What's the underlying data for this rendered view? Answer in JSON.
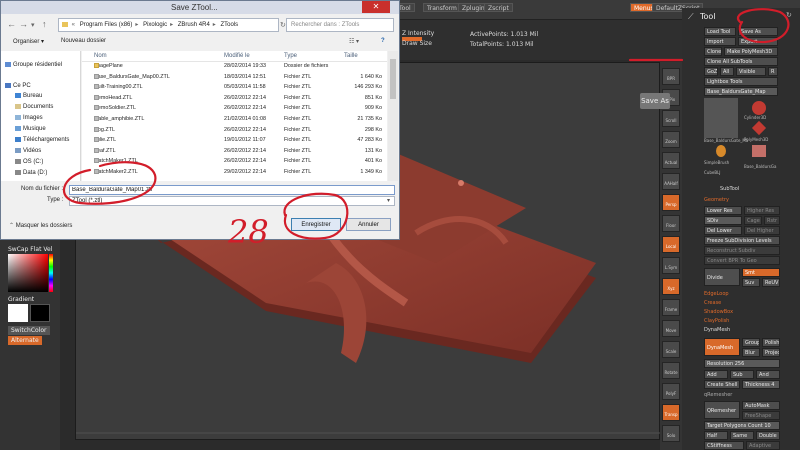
{
  "zbrush": {
    "top_menu": [
      "Tool",
      "Transform",
      "Zplugin",
      "Zscript"
    ],
    "top_right": [
      "Menus",
      "DefaultZScript"
    ],
    "shelf": {
      "left_labels": [
        "Z Intensity",
        "Draw Size"
      ],
      "active_points": "ActivePoints: 1.013 Mil",
      "total_points": "TotalPoints: 1.013 Mil"
    },
    "save_as_tooltip": "Save As",
    "left_palette": {
      "gradient": "Gradient",
      "switch_color": "SwitchColor",
      "alternate": "Alternate",
      "top_label": "SwCap  Flat  Vel"
    },
    "right_strip": [
      "BPR",
      "SPix",
      "Scroll",
      "Zoom",
      "Actual",
      "AAHalf",
      "Persp",
      "Floor",
      "Local",
      "L.Sym",
      "Xyz",
      "Frame",
      "Move",
      "Scale",
      "Rotate",
      "PolyF",
      "Transp",
      "Solo"
    ],
    "tool_palette": {
      "title": "Tool",
      "buttons": {
        "load_tool": "Load Tool",
        "save_as": "Save As",
        "import": "Import",
        "export": "Export",
        "clone": "Clone",
        "make_polymesh": "Make PolyMesh3D",
        "clone_all": "Clone All SubTools",
        "goz": "GoZ",
        "all": "All",
        "visible": "Visible",
        "r": "R",
        "lightbox_tools": "Lightbox Tools",
        "current_tool": "Base_BaldursGate_Map"
      },
      "thumbs": [
        "Base_BaldursGate_Ma",
        "Cylinder3D",
        "PolyMesh3D",
        "SimpleBrush",
        "CubeBLJ",
        "Base_BaldursGa"
      ],
      "subtool_header": "SubTool",
      "geometry_header": "Geometry",
      "rows": [
        [
          "Lower Res",
          "Higher Res"
        ],
        [
          "SDiv",
          "Cage",
          "Rstr"
        ],
        [
          "Del Lower",
          "Del Higher"
        ],
        [
          "Freeze SubDivision Levels"
        ],
        [
          "Reconstruct Subdiv"
        ],
        [
          "Convert BPR To Geo"
        ]
      ],
      "divide": "Divide",
      "smt": "Smt",
      "suv": "Suv",
      "reuv": "ReUV",
      "sections": [
        "EdgeLoop",
        "Crease",
        "ShadowBox",
        "ClayPolish",
        "DynaMesh"
      ],
      "dynamesh": "DynaMesh",
      "group": "Group",
      "polish": "Polish",
      "blur": "Blur",
      "project": "Project",
      "resolution": "Resolution 256",
      "add": "Add",
      "sub": "Sub",
      "and": "And",
      "create_shell": "Create Shell",
      "thickness": "Thickness 4",
      "qremesher_hdr": "qRemesher",
      "qremesher": "QRemesher",
      "automask": "AutoMask",
      "freeshape": "FreeShape",
      "target_polygons": "Target Polygons Count 10",
      "half": "Half",
      "same": "Same",
      "double": "Double",
      "adaptive": "Adaptive",
      "cstiffness": "CStiffness"
    }
  },
  "dialog": {
    "title": "Save ZTool...",
    "close": "✕",
    "help": "?",
    "breadcrumb": [
      "Program Files (x86)",
      "Pixologic",
      "ZBrush 4R4",
      "ZTools"
    ],
    "search_placeholder": "Rechercher dans : ZTools",
    "organize": "Organiser ▾",
    "new_folder": "Nouveau dossier",
    "nav_items": [
      "Groupe résidentiel",
      "Ce PC",
      "Bureau",
      "Documents",
      "Images",
      "Musique",
      "Téléchargements",
      "Vidéos",
      "OS (C:)",
      "Data (D:)"
    ],
    "columns": [
      "Nom",
      "Modifié le",
      "Type",
      "Taille"
    ],
    "files": [
      {
        "name": "ImagePlane",
        "date": "28/02/2014 19:33",
        "type": "Dossier de fichiers",
        "size": "",
        "folder": true
      },
      {
        "name": "Base_BaldursGate_Map00.ZTL",
        "date": "18/03/2014 12:51",
        "type": "Fichier ZTL",
        "size": "1 640 Ko"
      },
      {
        "name": "Built-Training00.ZTL",
        "date": "05/03/2014 11:58",
        "type": "Fichier ZTL",
        "size": "146 293 Ko"
      },
      {
        "name": "DemoHead.ZTL",
        "date": "26/02/2012 22:14",
        "type": "Fichier ZTL",
        "size": "851 Ko"
      },
      {
        "name": "DemoSoldier.ZTL",
        "date": "26/02/2012 22:14",
        "type": "Fichier ZTL",
        "size": "909 Ko"
      },
      {
        "name": "diable_amphibie.ZTL",
        "date": "21/02/2014 01:08",
        "type": "Fichier ZTL",
        "size": "21 735 Ko"
      },
      {
        "name": "Dog.ZTL",
        "date": "26/02/2012 22:14",
        "type": "Fichier ZTL",
        "size": "298 Ko"
      },
      {
        "name": "Julie.ZTL",
        "date": "19/01/2012 11:07",
        "type": "Fichier ZTL",
        "size": "47 283 Ko"
      },
      {
        "name": "Leaf.ZTL",
        "date": "26/02/2012 22:14",
        "type": "Fichier ZTL",
        "size": "131 Ko"
      },
      {
        "name": "MatchMaker1.ZTL",
        "date": "26/02/2012 22:14",
        "type": "Fichier ZTL",
        "size": "401 Ko"
      },
      {
        "name": "MatchMaker2.ZTL",
        "date": "29/02/2012 22:14",
        "type": "Fichier ZTL",
        "size": "1 349 Ko"
      }
    ],
    "filename_label": "Nom du fichier :",
    "filename_value": "Base_BalduraGate_Map01.ztl",
    "type_label": "Type :",
    "type_value": "ZTool (*.ztl)",
    "hide_folders": "Masquer les dossiers",
    "save_button": "Enregistrer",
    "cancel_button": "Annuler"
  },
  "annotation": {
    "handwritten_number": "28",
    "ink_color": "#d21d2a"
  },
  "colors": {
    "accent_orange": "#d8692a",
    "clay_red": "#8a3a30",
    "win_blue": "#3c7fb1"
  }
}
